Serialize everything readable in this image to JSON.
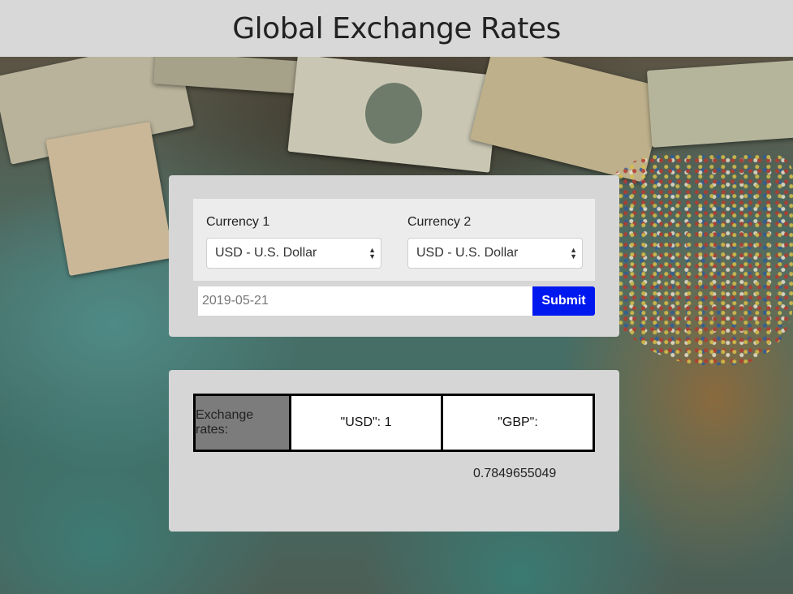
{
  "header": {
    "title": "Global Exchange Rates"
  },
  "form": {
    "currency1": {
      "label": "Currency 1",
      "selected": "USD - U.S. Dollar"
    },
    "currency2": {
      "label": "Currency 2",
      "selected": "USD - U.S. Dollar"
    },
    "date": {
      "value": "2019-05-21"
    },
    "submit_label": "Submit"
  },
  "result": {
    "label": "Exchange rates:",
    "usd": "\"USD\": 1",
    "gbp_key": "\"GBP\":",
    "gbp_value": "0.7849655049"
  },
  "colors": {
    "header_bg": "#d8d8d8",
    "panel_bg": "#d6d6d6",
    "submit_bg": "#0018f0",
    "label_cell_bg": "#7c7c7c"
  }
}
